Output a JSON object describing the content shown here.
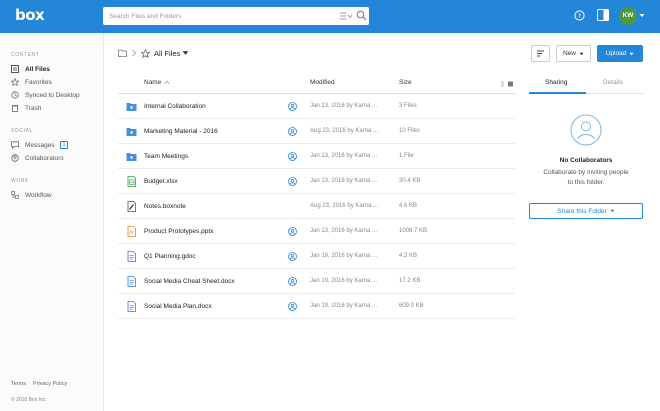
{
  "app": {
    "logo": "box"
  },
  "search": {
    "placeholder": "Search Files and Folders"
  },
  "user": {
    "initials": "KW"
  },
  "sidebar": {
    "content_heading": "CONTENT",
    "content_items": [
      {
        "label": "All Files",
        "icon": "all-files-icon",
        "active": true
      },
      {
        "label": "Favorites",
        "icon": "star-icon"
      },
      {
        "label": "Synced to Desktop",
        "icon": "sync-icon"
      },
      {
        "label": "Trash",
        "icon": "trash-icon"
      }
    ],
    "social_heading": "SOCIAL",
    "social_items": [
      {
        "label": "Messages",
        "icon": "message-icon",
        "badge": "1"
      },
      {
        "label": "Collaborators",
        "icon": "collaborators-icon"
      }
    ],
    "work_heading": "WORK",
    "work_items": [
      {
        "label": "Workflow",
        "icon": "workflow-icon"
      }
    ],
    "footer_links": [
      "Terms",
      "Privacy Policy"
    ],
    "copyright": "© 2016 Box Inc."
  },
  "breadcrumb": {
    "current": "All Files"
  },
  "toolbar": {
    "new_label": "New",
    "upload_label": "Upload"
  },
  "table": {
    "columns": {
      "name": "Name",
      "modified": "Modified",
      "size": "Size"
    },
    "rows": [
      {
        "name": "Internal Collaboration",
        "type": "collab-folder",
        "collab": true,
        "modified": "Jan 13, 2016 by Karna ...",
        "size": "3 Files"
      },
      {
        "name": "Marketing Material - 2016",
        "type": "collab-folder",
        "collab": true,
        "modified": "Aug 23, 2016 by Karna ...",
        "size": "10 Files"
      },
      {
        "name": "Team Meetings",
        "type": "collab-folder",
        "collab": true,
        "modified": "Jan 13, 2016 by Karna ...",
        "size": "1 File"
      },
      {
        "name": "Budget.xlsx",
        "type": "xlsx",
        "collab": true,
        "modified": "Jan 13, 2016 by Karna ...",
        "size": "30.4 KB"
      },
      {
        "name": "Notes.boxnote",
        "type": "boxnote",
        "collab": false,
        "modified": "Aug 23, 2016 by Karna ...",
        "size": "4.6 KB"
      },
      {
        "name": "Product Prototypes.pptx",
        "type": "pptx",
        "collab": true,
        "modified": "Jan 13, 2016 by Karna ...",
        "size": "1008.7 KB"
      },
      {
        "name": "Q1 Planning.gdoc",
        "type": "gdoc",
        "collab": true,
        "modified": "Jan 19, 2016 by Karna ...",
        "size": "4.2 KB"
      },
      {
        "name": "Social Media Cheat Sheet.docx",
        "type": "docx",
        "collab": true,
        "modified": "Jan 19, 2016 by Karna ...",
        "size": "17.2 KB"
      },
      {
        "name": "Social Media Plan.docx",
        "type": "docx",
        "collab": true,
        "modified": "Jan 19, 2016 by Karna ...",
        "size": "609.0 KB"
      }
    ]
  },
  "sidepanel": {
    "tabs": [
      "Sharing",
      "Details"
    ],
    "active_tab": "Sharing",
    "no_collab_title": "No Collaborators",
    "no_collab_text_1": "Collaborate by inviting people",
    "no_collab_text_2": "to this folder.",
    "share_button": "Share this Folder"
  },
  "colors": {
    "brand": "#2486d9",
    "avatar": "#4a9a3f"
  }
}
